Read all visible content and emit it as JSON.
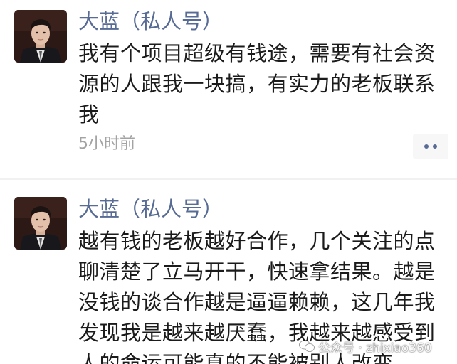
{
  "posts": [
    {
      "author": "大蓝（私人号）",
      "content": "我有个项目超级有钱途，需要有社会资源的人跟我一块搞，有实力的老板联系我",
      "time": "5小时前"
    },
    {
      "author": "大蓝（私人号）",
      "content": "越有钱的老板越好合作，几个关注的点聊清楚了立马开干，快速拿结果。越是没钱的谈合作越是逼逼赖赖，这几年我发现我是越来越厌蠢，我越来越感受到人的命运可能真的不能被别人改变。"
    }
  ],
  "more_icon": "more-dots-icon",
  "watermark": {
    "text": "公众号 · zhixiao360",
    "icon": "wechat-logo-icon"
  },
  "colors": {
    "name": "#576b95",
    "text": "#1b1b1b",
    "time": "#a3a3a3"
  }
}
